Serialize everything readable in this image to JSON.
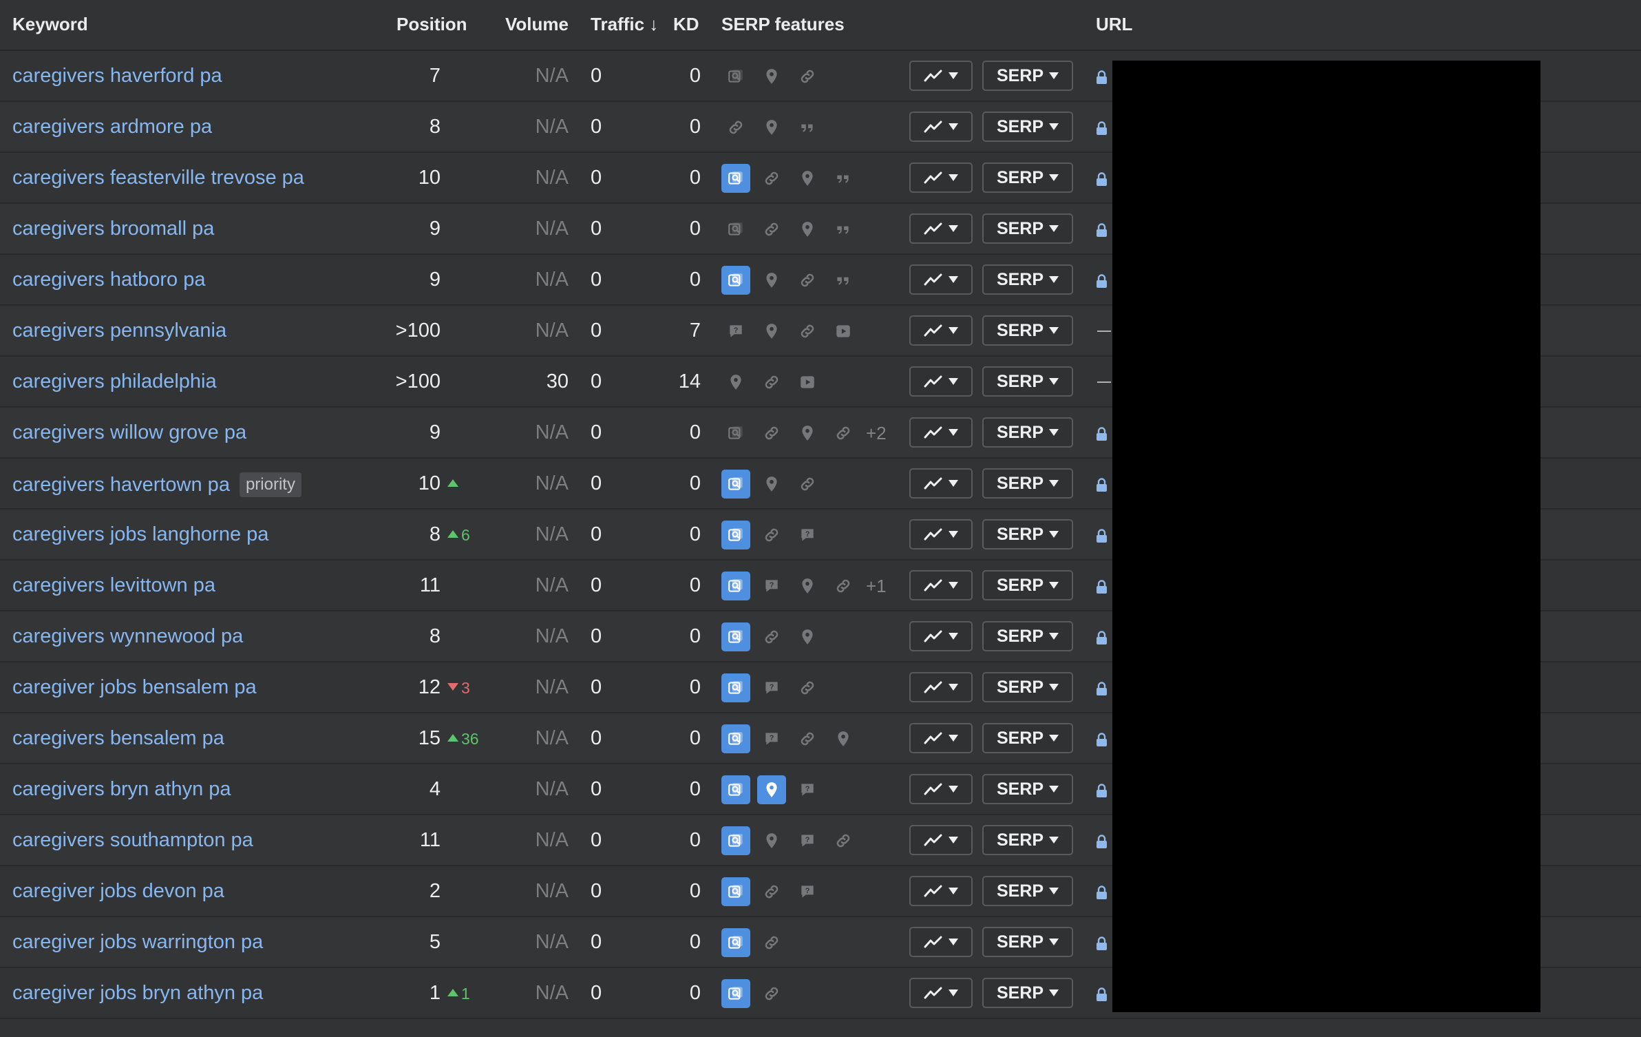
{
  "columns": {
    "keyword": "Keyword",
    "position": "Position",
    "volume": "Volume",
    "traffic": "Traffic",
    "traffic_sort": "↓",
    "kd": "KD",
    "serp_features": "SERP features",
    "url": "URL"
  },
  "buttons": {
    "serp_label": "SERP"
  },
  "rows": [
    {
      "keyword": "caregivers haverford pa",
      "tag": "",
      "position": "7",
      "change": "",
      "change_dir": "",
      "volume": "N/A",
      "traffic": "0",
      "kd": "0",
      "features": [
        [
          "image",
          false
        ],
        [
          "pin",
          false
        ],
        [
          "link",
          false
        ]
      ],
      "more": "",
      "url": "lock"
    },
    {
      "keyword": "caregivers ardmore pa",
      "tag": "",
      "position": "8",
      "change": "",
      "change_dir": "",
      "volume": "N/A",
      "traffic": "0",
      "kd": "0",
      "features": [
        [
          "link",
          false
        ],
        [
          "pin",
          false
        ],
        [
          "quote",
          false
        ]
      ],
      "more": "",
      "url": "lock"
    },
    {
      "keyword": "caregivers feasterville trevose pa",
      "tag": "",
      "position": "10",
      "change": "",
      "change_dir": "",
      "volume": "N/A",
      "traffic": "0",
      "kd": "0",
      "features": [
        [
          "image",
          true
        ],
        [
          "link",
          false
        ],
        [
          "pin",
          false
        ],
        [
          "quote",
          false
        ]
      ],
      "more": "",
      "url": "lock"
    },
    {
      "keyword": "caregivers broomall pa",
      "tag": "",
      "position": "9",
      "change": "",
      "change_dir": "",
      "volume": "N/A",
      "traffic": "0",
      "kd": "0",
      "features": [
        [
          "image",
          false
        ],
        [
          "link",
          false
        ],
        [
          "pin",
          false
        ],
        [
          "quote",
          false
        ]
      ],
      "more": "",
      "url": "lock"
    },
    {
      "keyword": "caregivers hatboro pa",
      "tag": "",
      "position": "9",
      "change": "",
      "change_dir": "",
      "volume": "N/A",
      "traffic": "0",
      "kd": "0",
      "features": [
        [
          "image",
          true
        ],
        [
          "pin",
          false
        ],
        [
          "link",
          false
        ],
        [
          "quote",
          false
        ]
      ],
      "more": "",
      "url": "lock"
    },
    {
      "keyword": "caregivers pennsylvania",
      "tag": "",
      "position": ">100",
      "change": "",
      "change_dir": "",
      "volume": "N/A",
      "traffic": "0",
      "kd": "7",
      "features": [
        [
          "faq",
          false
        ],
        [
          "pin",
          false
        ],
        [
          "link",
          false
        ],
        [
          "video",
          false
        ]
      ],
      "more": "",
      "url": "dash"
    },
    {
      "keyword": "caregivers philadelphia",
      "tag": "",
      "position": ">100",
      "change": "",
      "change_dir": "",
      "volume": "30",
      "traffic": "0",
      "kd": "14",
      "features": [
        [
          "pin",
          false
        ],
        [
          "link",
          false
        ],
        [
          "video",
          false
        ]
      ],
      "more": "",
      "url": "dash"
    },
    {
      "keyword": "caregivers willow grove pa",
      "tag": "",
      "position": "9",
      "change": "",
      "change_dir": "",
      "volume": "N/A",
      "traffic": "0",
      "kd": "0",
      "features": [
        [
          "image",
          false
        ],
        [
          "link",
          false
        ],
        [
          "pin",
          false
        ],
        [
          "link",
          false
        ]
      ],
      "more": "+2",
      "url": "lock"
    },
    {
      "keyword": "caregivers havertown pa",
      "tag": "priority",
      "position": "10",
      "change": "",
      "change_dir": "up",
      "volume": "N/A",
      "traffic": "0",
      "kd": "0",
      "features": [
        [
          "image",
          true
        ],
        [
          "pin",
          false
        ],
        [
          "link",
          false
        ]
      ],
      "more": "",
      "url": "lock"
    },
    {
      "keyword": "caregivers jobs langhorne pa",
      "tag": "",
      "position": "8",
      "change": "6",
      "change_dir": "up",
      "volume": "N/A",
      "traffic": "0",
      "kd": "0",
      "features": [
        [
          "image",
          true
        ],
        [
          "link",
          false
        ],
        [
          "faq",
          false
        ]
      ],
      "more": "",
      "url": "lock"
    },
    {
      "keyword": "caregivers levittown pa",
      "tag": "",
      "position": "11",
      "change": "",
      "change_dir": "",
      "volume": "N/A",
      "traffic": "0",
      "kd": "0",
      "features": [
        [
          "image",
          true
        ],
        [
          "faq",
          false
        ],
        [
          "pin",
          false
        ],
        [
          "link",
          false
        ]
      ],
      "more": "+1",
      "url": "lock"
    },
    {
      "keyword": "caregivers wynnewood pa",
      "tag": "",
      "position": "8",
      "change": "",
      "change_dir": "",
      "volume": "N/A",
      "traffic": "0",
      "kd": "0",
      "features": [
        [
          "image",
          true
        ],
        [
          "link",
          false
        ],
        [
          "pin",
          false
        ]
      ],
      "more": "",
      "url": "lock"
    },
    {
      "keyword": "caregiver jobs bensalem pa",
      "tag": "",
      "position": "12",
      "change": "3",
      "change_dir": "down",
      "volume": "N/A",
      "traffic": "0",
      "kd": "0",
      "features": [
        [
          "image",
          true
        ],
        [
          "faq",
          false
        ],
        [
          "link",
          false
        ]
      ],
      "more": "",
      "url": "lock"
    },
    {
      "keyword": "caregivers bensalem pa",
      "tag": "",
      "position": "15",
      "change": "36",
      "change_dir": "up",
      "volume": "N/A",
      "traffic": "0",
      "kd": "0",
      "features": [
        [
          "image",
          true
        ],
        [
          "faq",
          false
        ],
        [
          "link",
          false
        ],
        [
          "pin",
          false
        ]
      ],
      "more": "",
      "url": "lock"
    },
    {
      "keyword": "caregivers bryn athyn pa",
      "tag": "",
      "position": "4",
      "change": "",
      "change_dir": "",
      "volume": "N/A",
      "traffic": "0",
      "kd": "0",
      "features": [
        [
          "image",
          true
        ],
        [
          "pin",
          true
        ],
        [
          "faq",
          false
        ]
      ],
      "more": "",
      "url": "lock"
    },
    {
      "keyword": "caregivers southampton pa",
      "tag": "",
      "position": "11",
      "change": "",
      "change_dir": "",
      "volume": "N/A",
      "traffic": "0",
      "kd": "0",
      "features": [
        [
          "image",
          true
        ],
        [
          "pin",
          false
        ],
        [
          "faq",
          false
        ],
        [
          "link",
          false
        ]
      ],
      "more": "",
      "url": "lock"
    },
    {
      "keyword": "caregiver jobs devon pa",
      "tag": "",
      "position": "2",
      "change": "",
      "change_dir": "",
      "volume": "N/A",
      "traffic": "0",
      "kd": "0",
      "features": [
        [
          "image",
          true
        ],
        [
          "link",
          false
        ],
        [
          "faq",
          false
        ]
      ],
      "more": "",
      "url": "lock"
    },
    {
      "keyword": "caregiver jobs warrington pa",
      "tag": "",
      "position": "5",
      "change": "",
      "change_dir": "",
      "volume": "N/A",
      "traffic": "0",
      "kd": "0",
      "features": [
        [
          "image",
          true
        ],
        [
          "link",
          false
        ]
      ],
      "more": "",
      "url": "lock"
    },
    {
      "keyword": "caregiver jobs bryn athyn pa",
      "tag": "",
      "position": "1",
      "change": "1",
      "change_dir": "up",
      "volume": "N/A",
      "traffic": "0",
      "kd": "0",
      "features": [
        [
          "image",
          true
        ],
        [
          "link",
          false
        ]
      ],
      "more": "",
      "url": "lock"
    }
  ],
  "colors": {
    "background": "#323335",
    "keyword_link": "#87b7f0",
    "feature_highlight": "#4f8fe0",
    "change_up": "#5cc46a",
    "change_down": "#e36b6b"
  }
}
